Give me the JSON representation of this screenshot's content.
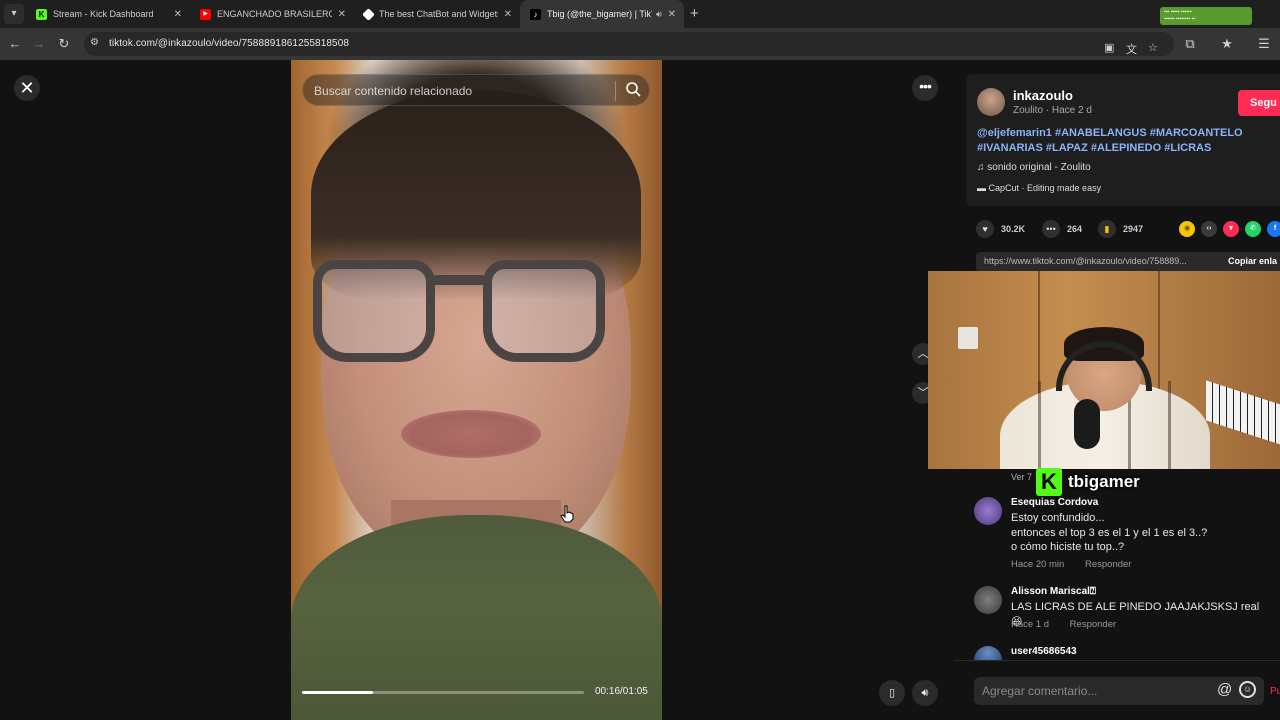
{
  "browser": {
    "tabs": [
      {
        "title": "Stream - Kick Dashboard",
        "favicon": "kick-icon",
        "color": "#53fc18"
      },
      {
        "title": "ENGANCHADO BRASILERO FU",
        "favicon": "youtube-icon",
        "color": "#ff0000"
      },
      {
        "title": "The best ChatBot and Widgets",
        "favicon": "streamelements-icon",
        "color": "#ffffff"
      },
      {
        "title": "Tbig (@the_bigamer) | TikTo",
        "favicon": "tiktok-icon",
        "color": "#000000"
      }
    ],
    "url": "tiktok.com/@inkazoulo/video/7588891861255818508"
  },
  "video": {
    "search_placeholder": "Buscar contenido relacionado",
    "time": "00:16/01:05",
    "progress_fraction": 0.25
  },
  "author": {
    "username": "inkazoulo",
    "subtitle": "Zoulito · Hace 2 d",
    "follow_label": "Segu",
    "hashtags": "@eljefemarin1 #ANABELANGUS #MARCOANTELO #IVANARIAS #LAPAZ #ALEPINEDO #LICRAS",
    "music": "sonido original - Zoulito",
    "capcut": "CapCut · Editing made easy"
  },
  "stats": {
    "likes": "30.2K",
    "comments": "264",
    "saves": "2947"
  },
  "share": {
    "link": "https://www.tiktok.com/@inkazoulo/video/758889...",
    "copy_label": "Copiar enla"
  },
  "overlay": {
    "brand_name": "tbigamer",
    "brand_color": "#53fc18",
    "ver_label": "Ver 7"
  },
  "comments": [
    {
      "author": "Esequias Cordova",
      "lines": [
        "Estoy confundido...",
        "entonces el top 3 es el 1 y el 1 es el 3..?",
        "o cómo hiciste tu top..?"
      ],
      "time": "Hace 20 min",
      "reply": "Responder"
    },
    {
      "author": "Alisson Mariscal",
      "lines": [
        "LAS LICRAS DE ALE PINEDO JAAJAKJSKSJ real"
      ],
      "time": "Hace 1 d",
      "reply": "Responder"
    },
    {
      "author": "user45686543",
      "lines": [],
      "time": "",
      "reply": ""
    }
  ],
  "comment_input": {
    "placeholder": "Agregar comentario...",
    "post_label": "Pu"
  }
}
